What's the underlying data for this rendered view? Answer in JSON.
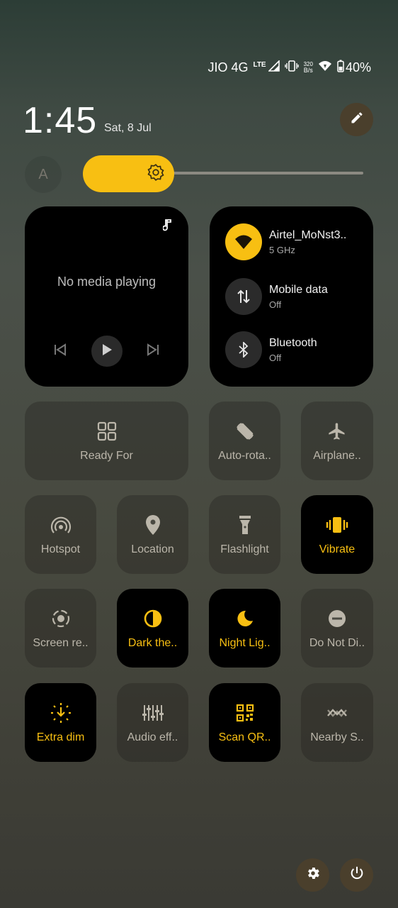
{
  "status_bar": {
    "carrier": "JIO 4G",
    "network_type": "LTE",
    "net_speed_value": "320",
    "net_speed_unit": "B/s",
    "battery": "40%"
  },
  "header": {
    "time": "1:45",
    "date": "Sat, 8 Jul"
  },
  "brightness": {
    "auto_label": "A",
    "level_percent": 30
  },
  "media": {
    "status_text": "No media playing"
  },
  "connectivity": {
    "wifi": {
      "name": "Airtel_MoNst3..",
      "detail": "5 GHz",
      "on": true
    },
    "mobile_data": {
      "name": "Mobile data",
      "detail": "Off",
      "on": false
    },
    "bluetooth": {
      "name": "Bluetooth",
      "detail": "Off",
      "on": false
    }
  },
  "tiles": {
    "ready_for": {
      "label": "Ready For",
      "on": false
    },
    "auto_rotate": {
      "label": "Auto-rota..",
      "on": false
    },
    "airplane": {
      "label": "Airplane..",
      "on": false
    },
    "hotspot": {
      "label": "Hotspot",
      "on": false
    },
    "location": {
      "label": "Location",
      "on": false
    },
    "flashlight": {
      "label": "Flashlight",
      "on": false
    },
    "vibrate": {
      "label": "Vibrate",
      "on": true
    },
    "screen_record": {
      "label": "Screen re..",
      "on": false
    },
    "dark_theme": {
      "label": "Dark the..",
      "on": true
    },
    "night_light": {
      "label": "Night Lig..",
      "on": true
    },
    "do_not_disturb": {
      "label": "Do Not Di..",
      "on": false
    },
    "extra_dim": {
      "label": "Extra dim",
      "on": true
    },
    "audio_effects": {
      "label": "Audio eff..",
      "on": false
    },
    "scan_qr": {
      "label": "Scan QR..",
      "on": true
    },
    "nearby_share": {
      "label": "Nearby S..",
      "on": false
    }
  },
  "colors": {
    "accent": "#f8bf12",
    "tile_on_bg": "#000000",
    "tile_off_label": "#bbb6aa",
    "round_button_bg": "#4a3f2c"
  }
}
